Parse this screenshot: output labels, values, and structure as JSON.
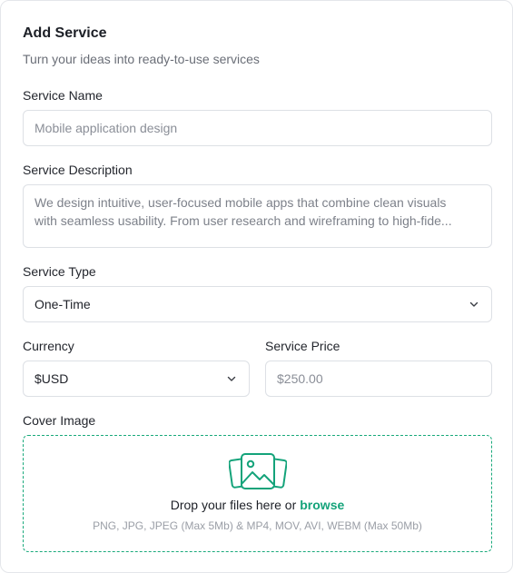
{
  "header": {
    "title": "Add Service",
    "subtitle": "Turn your ideas into ready-to-use services"
  },
  "service_name": {
    "label": "Service Name",
    "placeholder": "Mobile application design"
  },
  "service_description": {
    "label": "Service Description",
    "line1": "We design intuitive, user-focused mobile apps that combine clean visuals",
    "line2": "with seamless usability. From user research and wireframing to high-fide..."
  },
  "service_type": {
    "label": "Service Type",
    "value": "One-Time"
  },
  "currency": {
    "label": "Currency",
    "value": "$USD"
  },
  "service_price": {
    "label": "Service Price",
    "placeholder": "$250.00"
  },
  "cover_image": {
    "label": "Cover Image",
    "drop_text": "Drop your files here or",
    "browse_label": "browse",
    "hint": "PNG, JPG, JPEG (Max 5Mb) & MP4, MOV, AVI, WEBM (Max 50Mb)",
    "icon": "images-icon"
  },
  "colors": {
    "accent": "#14a37a",
    "border": "#dde0e5"
  }
}
